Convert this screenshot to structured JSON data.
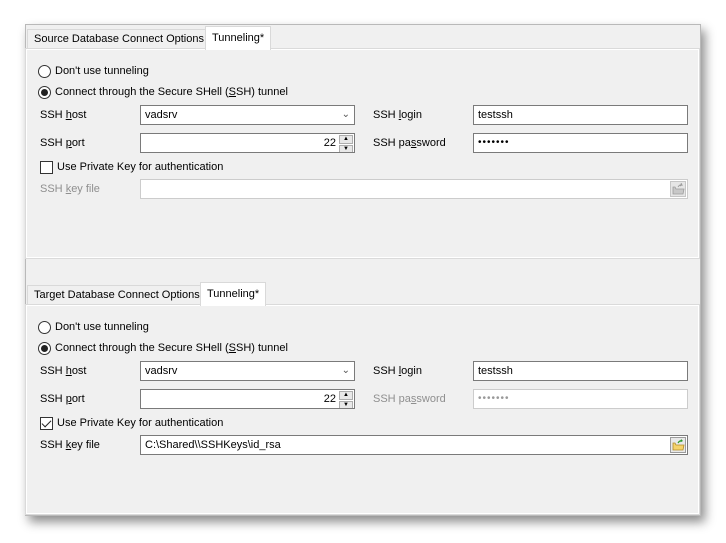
{
  "source": {
    "tabs": [
      {
        "label": "Source Database Connect Options",
        "active": false
      },
      {
        "label": "Tunneling*",
        "active": true
      }
    ],
    "radio_none": {
      "label": "Don't use tunneling",
      "checked": false
    },
    "radio_ssh": {
      "label_pre": "Connect through the Secure SHell (",
      "label_u": "S",
      "label_post": "SH) tunnel",
      "checked": true
    },
    "host": {
      "label_pre": "SSH ",
      "label_u": "h",
      "label_post": "ost",
      "value": "vadsrv"
    },
    "port": {
      "label_pre": "SSH ",
      "label_u": "p",
      "label_post": "ort",
      "value": "22"
    },
    "login": {
      "label_pre": "SSH ",
      "label_u": "l",
      "label_post": "ogin",
      "value": "testssh"
    },
    "password": {
      "label_pre": "SSH pa",
      "label_u": "s",
      "label_post": "sword",
      "value": "•••••••",
      "enabled": true
    },
    "private_key": {
      "label": "Use Private Key for authentication",
      "checked": false
    },
    "key_file": {
      "label_pre": "SSH ",
      "label_u": "k",
      "label_post": "ey file",
      "value": "",
      "enabled": false
    }
  },
  "target": {
    "tabs": [
      {
        "label": "Target Database Connect Options",
        "active": false
      },
      {
        "label": "Tunneling*",
        "active": true
      }
    ],
    "radio_none": {
      "label": "Don't use tunneling",
      "checked": false
    },
    "radio_ssh": {
      "label_pre": "Connect through the Secure SHell (",
      "label_u": "S",
      "label_post": "SH) tunnel",
      "checked": true
    },
    "host": {
      "label_pre": "SSH ",
      "label_u": "h",
      "label_post": "ost",
      "value": "vadsrv"
    },
    "port": {
      "label_pre": "SSH ",
      "label_u": "p",
      "label_post": "ort",
      "value": "22"
    },
    "login": {
      "label_pre": "SSH ",
      "label_u": "l",
      "label_post": "ogin",
      "value": "testssh"
    },
    "password": {
      "label_pre": "SSH pa",
      "label_u": "s",
      "label_post": "sword",
      "value": "•••••••",
      "enabled": false
    },
    "private_key": {
      "label": "Use Private Key for authentication",
      "checked": true
    },
    "key_file": {
      "label_pre": "SSH ",
      "label_u": "k",
      "label_post": "ey file",
      "value": "C:\\Shared\\\\SSHKeys\\id_rsa",
      "enabled": true
    }
  },
  "icons": {
    "combo_arrow": "chevron-down-icon",
    "spin_up": "▲",
    "spin_down": "▼",
    "browse": "folder-open-icon"
  }
}
